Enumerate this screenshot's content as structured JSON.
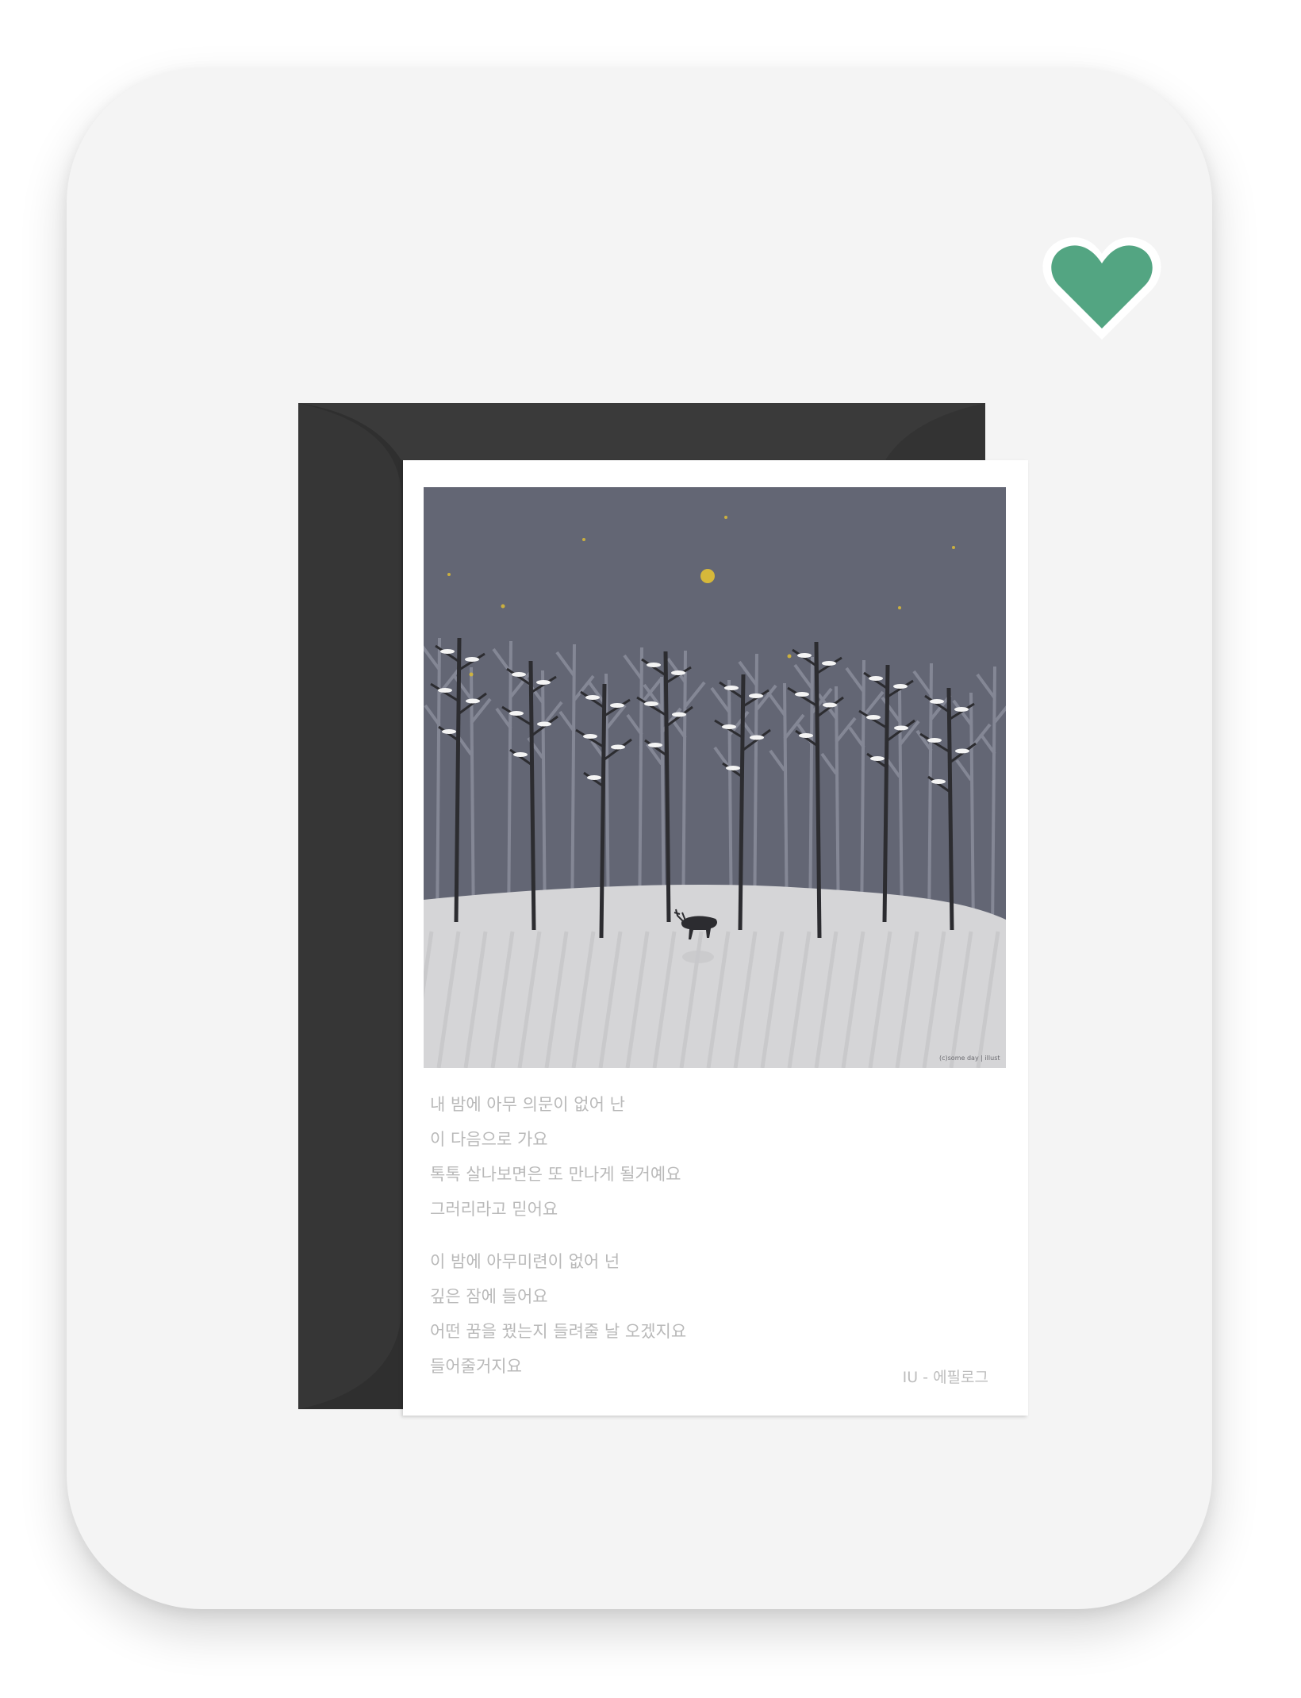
{
  "favorite": {
    "icon": "heart-icon",
    "color": "#53a582"
  },
  "postcard": {
    "artwork": {
      "description_icon": "snowy-forest-deer-illustration",
      "sky_color": "#636674",
      "snow_color": "#d5d5d7",
      "moon_color": "#d6b83a",
      "signature": "(c)some day | illust"
    },
    "lyrics": {
      "stanza1": [
        "내 밤에 아무 의문이 없어 난",
        "이 다음으로 가요",
        "톡톡 살나보면은 또 만나게 될거예요",
        "그러리라고 믿어요"
      ],
      "stanza2": [
        "이 밤에 아무미련이 없어 넌",
        "깊은 잠에 들어요",
        "어떤 꿈을 꿨는지 들려줄 날 오겠지요",
        "들어줄거지요"
      ]
    },
    "credit": "IU - 에필로그"
  }
}
